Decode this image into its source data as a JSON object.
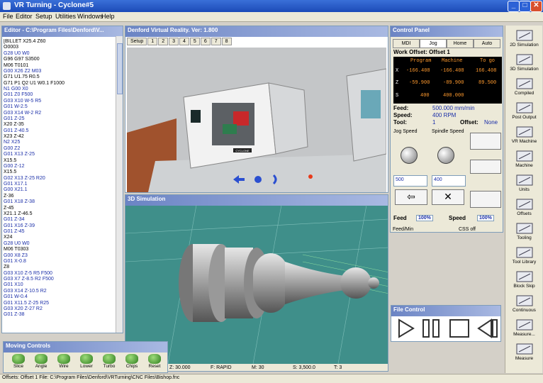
{
  "window": {
    "title": "VR Turning - Cyclone#5",
    "min": "_",
    "max": "□",
    "close": "✕"
  },
  "menu": [
    "File",
    "Editor",
    "Setup",
    "Utilities",
    "Windows",
    "Help"
  ],
  "editor": {
    "title": "Editor - C:\\Program Files\\Denford\\V...",
    "lines": [
      "[BILLET X25.4 Z60",
      "O0003",
      "G28 U0 W0",
      "G96 G97 S3500",
      "M06 T0101",
      "G00 X26 Z2 M03",
      "G71 U1.75 R0.5",
      "G71 P1 Q2 U1 W0.1 F1000",
      "N1 G00 X0",
      "G01 Z0 F500",
      "G03 X10 W-5 R5",
      "G01 W-2.5",
      "G03 X14 W-2 R2",
      "G01 Z-25",
      "X20 Z-35",
      "G01 Z-40.5",
      "X23 Z-42",
      "N2 X25",
      "G00 Z2",
      "G01 X13 Z-25",
      "X15.5",
      "G00 Z-12",
      "X15.5",
      "G02 X13 Z-25 R20",
      "G01 X17.1",
      "G00 X21.1",
      "Z-36",
      "G01 X18 Z-38",
      "Z-45",
      "X21.1 Z-46.5",
      "G01 Z-34",
      "G01 X16 Z-39",
      "G01 Z-45",
      "X24",
      "G28 U0 W0",
      "M06 T0303",
      "G00 X8 Z3",
      "G01 X-0.8",
      "Z8",
      "G03 X10 Z-5 R5 F500",
      "G03 X7 Z-8.5 R2 F500",
      "G01 X10",
      "G03 X14 Z-10.5 R2",
      "G01 W-0.4",
      "G01 X11.5 Z-25 R25",
      "G03 X20 Z-27 R2",
      "G01 Z-38"
    ]
  },
  "vr": {
    "title": "Denford Virtual Reality.  Ver: 1.800",
    "tabs": [
      "Setup",
      "1",
      "2",
      "3",
      "4",
      "5",
      "6",
      "7",
      "8"
    ],
    "machine_brand": "CYCLONE"
  },
  "sim": {
    "title": "3D Simulation",
    "status": [
      "X: 26.000",
      "Z: 30.000",
      "F: RAPID",
      "M: 30",
      "S: 3,500.0",
      "T: 3"
    ]
  },
  "control_panel": {
    "title": "Control Panel",
    "tabs": [
      "MDI",
      "Jog",
      "Home",
      "Auto"
    ],
    "active_tab": "Jog",
    "work_offset": "Work Offset: Offset 1",
    "dro_headers": [
      "Program",
      "Machine",
      "To go"
    ],
    "dro_rows": [
      {
        "axis": "X",
        "program": "-166.408",
        "machine": "-166.408",
        "togo": "166.408"
      },
      {
        "axis": "Z",
        "program": "-59.900",
        "machine": "-89.900",
        "togo": "89.500"
      },
      {
        "axis": "S",
        "program": "400",
        "machine": "400.000",
        "togo": ""
      }
    ],
    "feed_label": "Feed:",
    "feed_value": "500.000 mm/min",
    "speed_label": "Speed:",
    "speed_value": "400 RPM",
    "tool_label": "Tool:",
    "tool_value": "1",
    "offset_label": "Offset:",
    "offset_value": "None",
    "jog_speed_label": "Jog Speed",
    "spindle_speed_label": "Spindle Speed",
    "jog_speed_input": "500",
    "spindle_speed_input": "400",
    "feed_override_label": "Feed",
    "feed_override": "100%",
    "speed_override_label": "Speed",
    "speed_override": "100%",
    "feed_units": "Feed/Min",
    "css": "CSS off"
  },
  "file_control": {
    "title": "File Control"
  },
  "right_bar": [
    "2D Simulation",
    "3D Simulation",
    "Compiled",
    "Post Output",
    "VR Machine",
    "Machine",
    "Units",
    "Offsets",
    "Tooling",
    "Tool Library",
    "Block Skip",
    "Continuous",
    "Measure...",
    "Measure"
  ],
  "moving": {
    "title": "Moving Controls",
    "items": [
      "Slice",
      "Angle",
      "Wire",
      "Lower",
      "Turbo",
      "Chips",
      "Reset"
    ]
  },
  "statusbar": "Offsets: Offset 1  File: C:\\Program Files\\Denford\\VRTurning\\CNC Files\\Bishop.fnc",
  "colors": {
    "title_bg": "#1c4bb8",
    "panel_title": "#6b84c4",
    "dro_text": "#ff9a2e",
    "sim_bg": "#3f8f8a",
    "gcode_blue": "#1a2ea8"
  }
}
